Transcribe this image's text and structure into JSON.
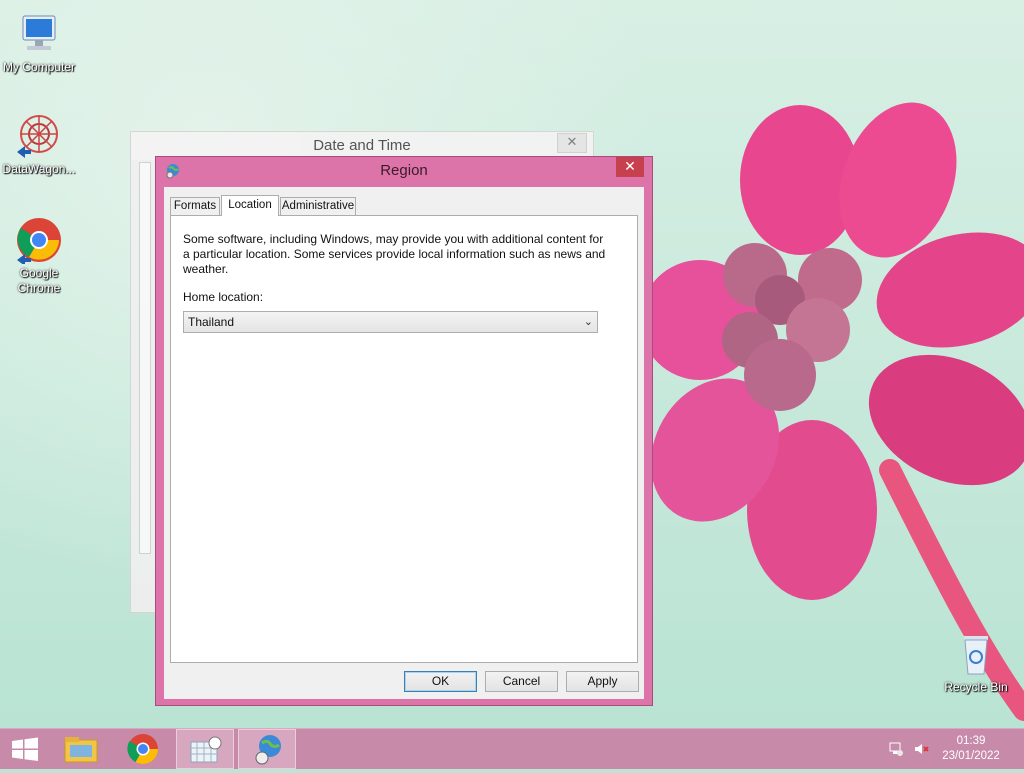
{
  "desktop": {
    "icons": [
      {
        "label": "My Computer"
      },
      {
        "label": "DataWagon..."
      },
      {
        "label": "Google Chrome"
      },
      {
        "label": "Recycle Bin"
      }
    ]
  },
  "date_time_window": {
    "title": "Date and Time",
    "close_glyph": "✕"
  },
  "region_dialog": {
    "title": "Region",
    "close_glyph": "✕",
    "tabs": [
      {
        "label": "Formats"
      },
      {
        "label": "Location"
      },
      {
        "label": "Administrative"
      }
    ],
    "active_tab": "Location",
    "description": "Some software, including Windows, may provide you with additional content for a particular location. Some services provide local information such as news and weather.",
    "home_location_label": "Home location:",
    "home_location_value": "Thailand",
    "buttons": {
      "ok": "OK",
      "cancel": "Cancel",
      "apply": "Apply"
    }
  },
  "taskbar": {
    "clock_time": "01:39",
    "clock_date": "23/01/2022",
    "items": [
      "start-icon",
      "file-explorer-icon",
      "chrome-icon",
      "date-time-icon",
      "region-icon"
    ],
    "accent": "#c88aa9"
  },
  "colors": {
    "dialog_frame": "#dc74a9",
    "close_button": "#c7404e"
  }
}
